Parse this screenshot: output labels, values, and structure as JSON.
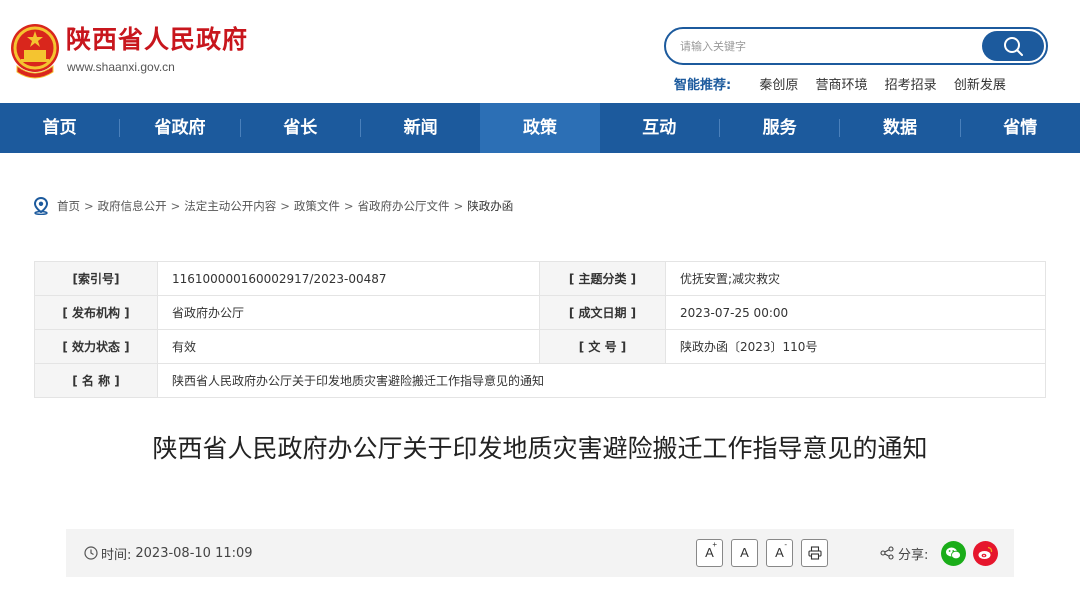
{
  "header": {
    "site_name": "陕西省人民政府",
    "site_url": "www.shaanxi.gov.cn",
    "search_placeholder": "请输入关键字",
    "recommend_label": "智能推荐:",
    "recommend_links": [
      "秦创原",
      "营商环境",
      "招考招录",
      "创新发展"
    ]
  },
  "nav": {
    "items": [
      "首页",
      "省政府",
      "省长",
      "新闻",
      "政策",
      "互动",
      "服务",
      "数据",
      "省情"
    ],
    "active": "政策"
  },
  "breadcrumb": {
    "items": [
      "首页",
      "政府信息公开",
      "法定主动公开内容",
      "政策文件",
      "省政府办公厅文件",
      "陕政办函"
    ],
    "separator": ">"
  },
  "info": {
    "index_label": "[索引号]",
    "index_value": "116100000160002917/2023-00487",
    "topic_label": "[ 主题分类 ]",
    "topic_value": "优抚安置;减灾救灾",
    "issuer_label": "[ 发布机构 ]",
    "issuer_value": "省政府办公厅",
    "date_label": "[ 成文日期 ]",
    "date_value": "2023-07-25 00:00",
    "status_label": "[ 效力状态 ]",
    "status_value": "有效",
    "docno_label": "[ 文 号 ]",
    "docno_value": "陕政办函〔2023〕110号",
    "name_label": "[ 名 称 ]",
    "name_value": "陕西省人民政府办公厅关于印发地质灾害避险搬迁工作指导意见的通知"
  },
  "article": {
    "title": "陕西省人民政府办公厅关于印发地质灾害避险搬迁工作指导意见的通知",
    "time_label": "时间:",
    "time_value": "2023-08-10 11:09",
    "font_large": "A",
    "font_medium": "A",
    "font_small": "A",
    "share_label": "分享:"
  },
  "colors": {
    "brand_red": "#c8161d",
    "nav_blue": "#1c5a9d",
    "nav_active": "#2c6fb5",
    "wechat_green": "#1aad19",
    "weibo_red": "#e6162d"
  }
}
